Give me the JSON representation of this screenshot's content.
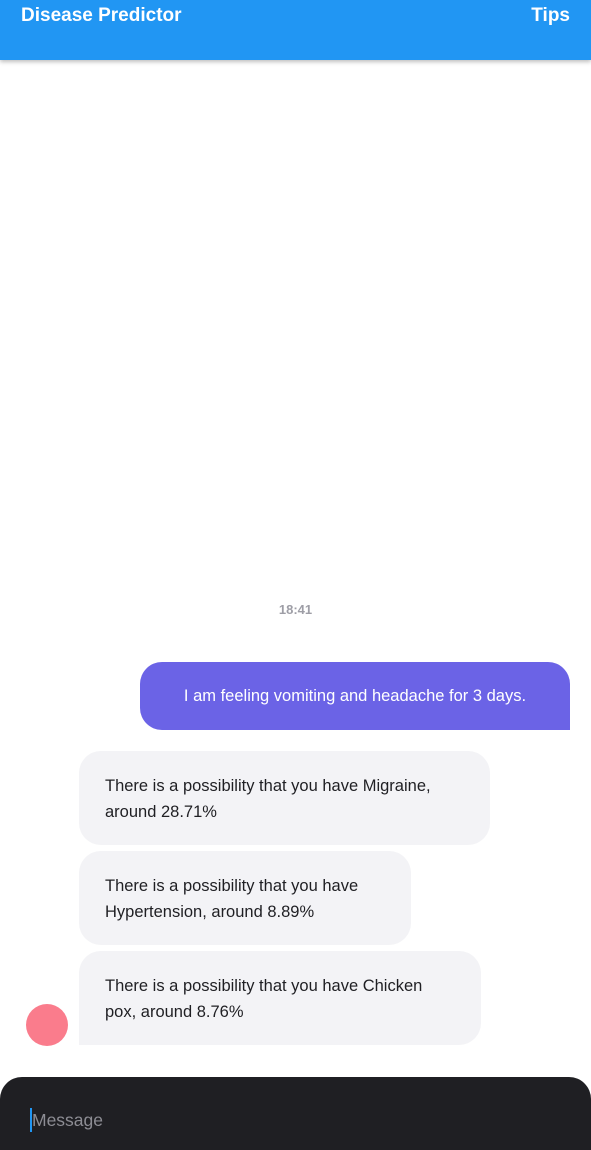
{
  "app_bar": {
    "title": "Disease Predictor",
    "tips_label": "Tips",
    "color": "#2196f3"
  },
  "chat": {
    "timestamp": "18:41",
    "user_message": "I am feeling vomiting and headache for 3 days.",
    "bot_messages": [
      {
        "line1": "There is a possibility that you have Migraine,",
        "line2": "around 28.71%"
      },
      {
        "line1": "There is a possibility that you have",
        "line2": "Hypertension, around 8.89%"
      },
      {
        "line1": "There is a possibility that you have Chicken",
        "line2": "pox, around 8.76%"
      }
    ],
    "user_bubble_color": "#6b63e6",
    "bot_bubble_color": "#f3f3f6",
    "avatar_color": "#fa7c8c"
  },
  "composer": {
    "placeholder": "Message",
    "background": "#1f1f23"
  }
}
